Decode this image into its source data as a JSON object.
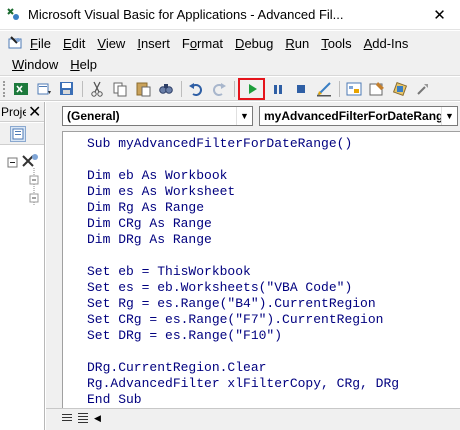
{
  "window": {
    "title": "Microsoft Visual Basic for Applications - Advanced Fil...",
    "close_glyph": "✕"
  },
  "menu": {
    "row1": [
      "File",
      "Edit",
      "View",
      "Insert",
      "Format",
      "Debug",
      "Run",
      "Tools",
      "Add-Ins"
    ],
    "row1_underline": [
      "F",
      "E",
      "V",
      "I",
      "o",
      "D",
      "R",
      "T",
      "A"
    ],
    "row2": [
      "Window",
      "Help"
    ],
    "row2_underline": [
      "W",
      "H"
    ]
  },
  "toolbar": {
    "buttons": [
      "excel-icon",
      "insert-module-icon",
      "save-icon",
      "cut-icon",
      "copy-icon",
      "paste-icon",
      "find-icon",
      "undo-icon",
      "redo-icon",
      "run-icon",
      "break-icon",
      "reset-icon",
      "design-mode-icon",
      "project-explorer-icon",
      "properties-icon",
      "object-browser-icon",
      "toolbox-icon"
    ],
    "run_highlight_color": "#e5141b",
    "run_color": "#1e9e3c"
  },
  "project_panel": {
    "title": "Proje",
    "close_glyph": "✕"
  },
  "code_window": {
    "object_combo": "(General)",
    "procedure_combo": "myAdvancedFilterForDateRang",
    "code_color": "#00007f",
    "lines": [
      "Sub myAdvancedFilterForDateRange()",
      "",
      "Dim eb As Workbook",
      "Dim es As Worksheet",
      "Dim Rg As Range",
      "Dim CRg As Range",
      "Dim DRg As Range",
      "",
      "Set eb = ThisWorkbook",
      "Set es = eb.Worksheets(\"VBA Code\")",
      "Set Rg = es.Range(\"B4\").CurrentRegion",
      "Set CRg = es.Range(\"F7\").CurrentRegion",
      "Set DRg = es.Range(\"F10\")",
      "",
      "DRg.CurrentRegion.Clear",
      "Rg.AdvancedFilter xlFilterCopy, CRg, DRg",
      "End Sub"
    ]
  }
}
